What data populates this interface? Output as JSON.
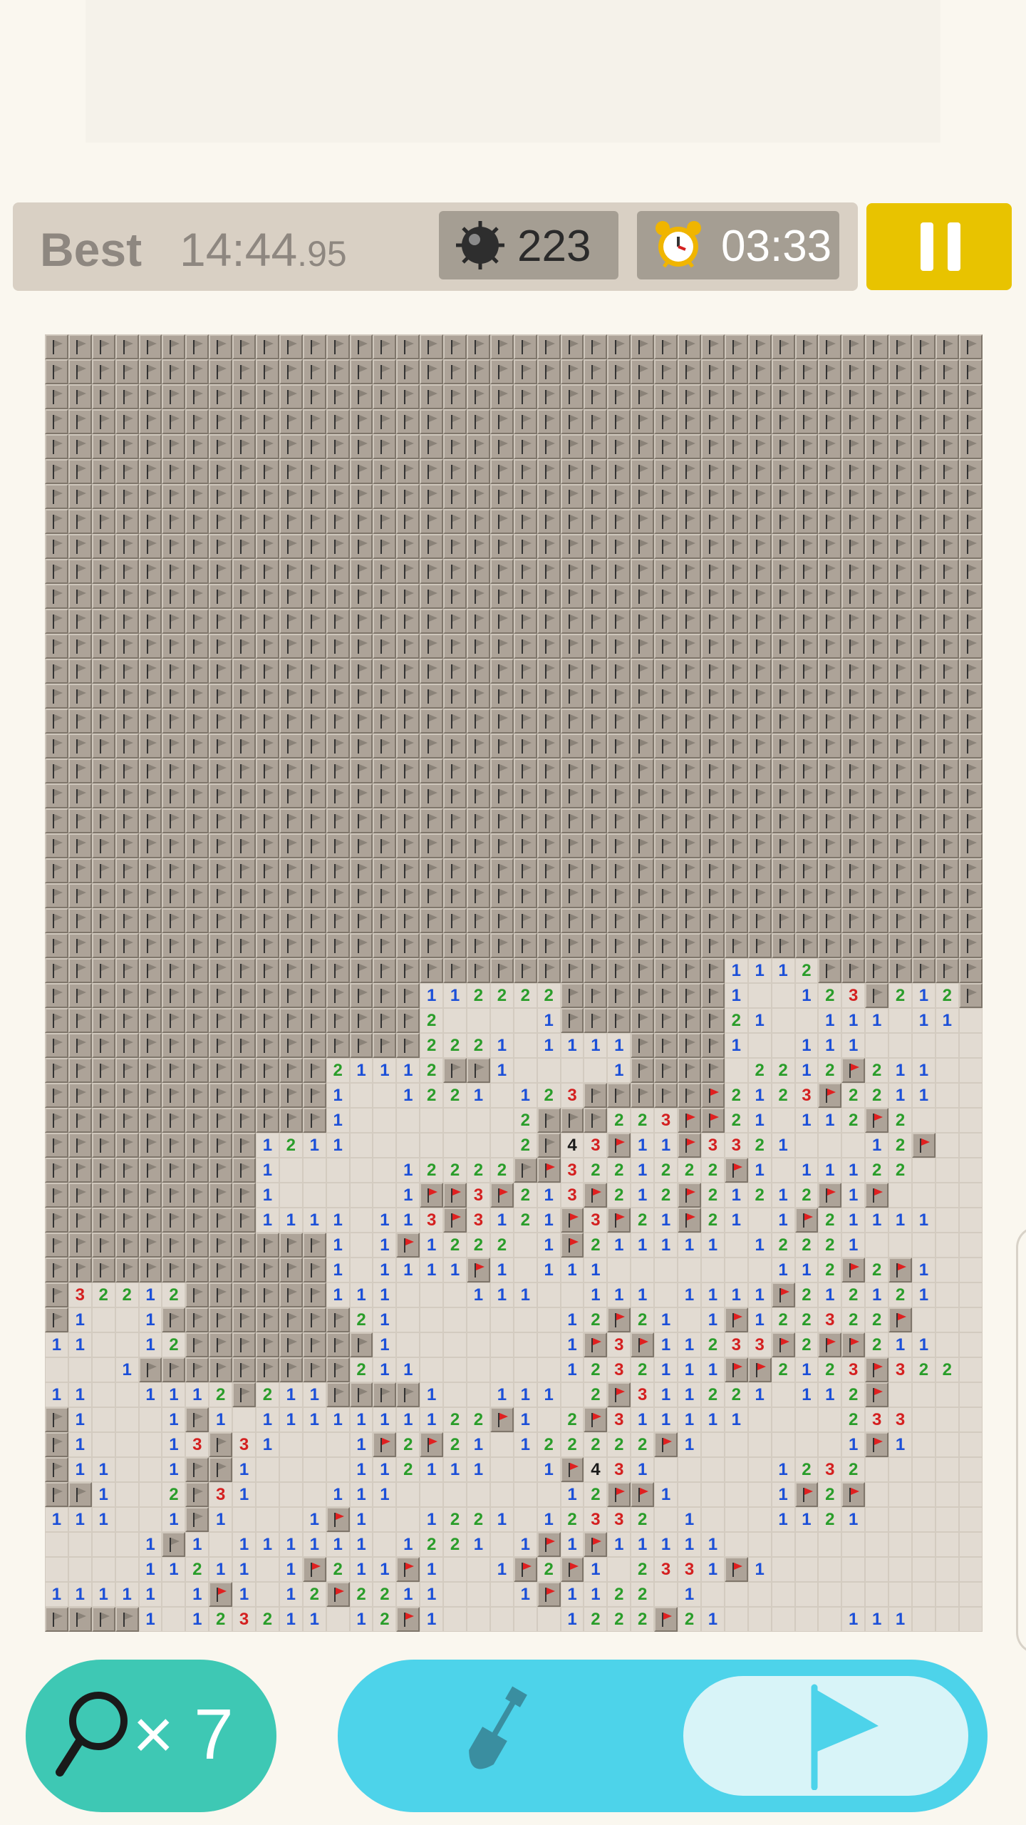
{
  "status_bar": {
    "best_label": "Best",
    "best_time_main": "14:44",
    "best_time_hundredths": ".95",
    "mines_remaining": "223",
    "timer": "03:33",
    "mine_icon": "mine-icon",
    "clock_icon": "alarm-clock-icon",
    "pause_icon": "pause-icon",
    "pause_color": "#e8c300"
  },
  "board": {
    "columns": 40,
    "rows": 52,
    "legend": {
      "#": "covered cell",
      "F": "flag (gray)",
      "R": "flag (red)",
      ".": "revealed empty",
      "1-4": "revealed number"
    },
    "grid": [
      "FFFFFFFFFFFFFFFFFFFFFFFFFFFFFFFFFFFFFFFF",
      "FFFFFFFFFFFFFFFFFFFFFFFFFFFFFFFFFFFFFFFF",
      "FFFFFFFFFFFFFFFFFFFFFFFFFFFFFFFFFFFFFFFF",
      "FFFFFFFFFFFFFFFFFFFFFFFFFFFFFFFFFFFFFFFF",
      "FFFFFFFFFFFFFFFFFFFFFFFFFFFFFFFFFFFFFFFF",
      "FFFFFFFFFFFFFFFFFFFFFFFFFFFFFFFFFFFFFFFF",
      "FFFFFFFFFFFFFFFFFFFFFFFFFFFFFFFFFFFFFFFF",
      "FFFFFFFFFFFFFFFFFFFFFFFFFFFFFFFFFFFFFFFF",
      "FFFFFFFFFFFFFFFFFFFFFFFFFFFFFFFFFFFFFFFF",
      "FFFFFFFFFFFFFFFFFFFFFFFFFFFFFFFFFFFFFFFF",
      "FFFFFFFFFFFFFFFFFFFFFFFFFFFFFFFFFFFFFFFF",
      "FFFFFFFFFFFFFFFFFFFFFFFFFFFFFFFFFFFFFFFF",
      "FFFFFFFFFFFFFFFFFFFFFFFFFFFFFFFFFFFFFFFF",
      "FFFFFFFFFFFFFFFFFFFFFFFFFFFFFFFFFFFFFFFF",
      "FFFFFFFFFFFFFFFFFFFFFFFFFFFFFFFFFFFFFFFF",
      "FFFFFFFFFFFFFFFFFFFFFFFFFFFFFFFFFFFFFFFF",
      "FFFFFFFFFFFFFFFFFFFFFFFFFFFFFFFFFFFFFFFF",
      "FFFFFFFFFFFFFFFFFFFFFFFFFFFFFFFFFFFFFFFF",
      "FFFFFFFFFFFFFFFFFFFFFFFFFFFFFFFFFFFFFFFF",
      "FFFFFFFFFFFFFFFFFFFFFFFFFFFFFFFFFFFFFFFF",
      "FFFFFFFFFFFFFFFFFFFFFFFFFFFFFFFFFFFFFFFF",
      "FFFFFFFFFFFFFFFFFFFFFFFFFFFFFFFFFFFFFFFF",
      "FFFFFFFFFFFFFFFFFFFFFFFFFFFFFFFFFFFFFFFF",
      "FFFFFFFFFFFFFFFFFFFFFFFFFFFFFFFFFFFFFFFF",
      "FFFFFFFFFFFFFFFFFFFFFFFFFFFFFFFFFFFFFFFF",
      "FFFFFFFFFFFFFFFFFFFFFFFFFFFFF1112FFFFFFF",
      "FFFFFFFFFFFFFFFF112222FFFFFFF1..123F212F",
      "FFFFFFFFFFFFFFFF2....1FFFFFFF21..111.11",
      "FFFFFFFFFFFFFFFF2221.1111FFFF1..111....",
      "FFFFFFFFFFFF21112FF1....1FFFF.2212R211.",
      "FFFFFFFFFFFF1..1221.123FFFFFR2123R2211",
      "FFFFFFFFFFFF1.......2FFF223RR21.112R2",
      "FFFFFFFFF1211.......2F43R11R3321...12R",
      "FFFFFFFFF1.....12222FR3221222R1.11122",
      "FFFFFFFFF1.....1RR3R213R212R21212R1R",
      "FFFFFFFFF1111.113R3121R3R21R21.1R21111",
      "FFFFFFFFFFFF1.1R1222.1R211111.12221",
      "FFFFFFFFFFFF1.1111R1.111.......112R2R1",
      "F32212FFFFFF111...111..111.1111R212121",
      "F1..1FFFFFFFF21.......12R21.1R122322R",
      "11..12FFFFFFFF1.......1R3R11233R2RR211",
      "...1FFFFFFFFF211......1232111RR2123R322",
      "11..1112F211FFFF1..111.2R311221.112R",
      "F1...1F1.1111111122R1.2R311111....233",
      "F1...13F31...1R2R21.122222R1......1R1",
      "F11..1FF1....112111..1R431.....1232",
      "FF1..2F31...111.......12RR1....1R2R",
      "111..1F1...1R1..1221.12332.1...1121",
      "....1F1.111111.1221.1R1R11111........",
      "....11211.1R211R1..1R2R1.2331R1.......",
      "11111.1R1.12R2211...1R1122.1........",
      "FFFF1.123211.12R1.....1222R21.....111"
    ]
  },
  "controls": {
    "hint_count": "× 7",
    "hint_icon": "magnifier-icon",
    "dig_icon": "shovel-icon",
    "flag_icon": "flag-icon",
    "hint_color": "#3ec8b4",
    "mode_color": "#4dd3ea"
  }
}
